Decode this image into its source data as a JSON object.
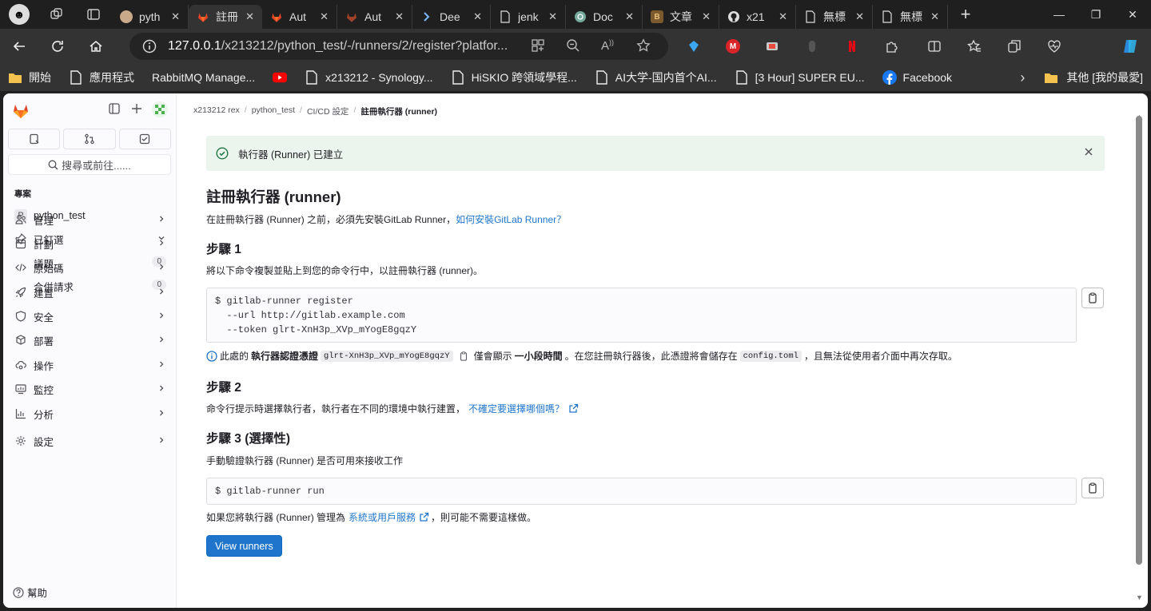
{
  "tabs": [
    {
      "title": "pyth",
      "fav": "person-avatar"
    },
    {
      "title": "註冊",
      "fav": "gitlab-fox",
      "active": true
    },
    {
      "title": "Aut",
      "fav": "gitlab-fox"
    },
    {
      "title": "Aut",
      "fav": "gitlab-fox-dark"
    },
    {
      "title": "Dee",
      "fav": "chevron-app"
    },
    {
      "title": "jenk",
      "fav": "document"
    },
    {
      "title": "Doc",
      "fav": "chatgpt"
    },
    {
      "title": "文章",
      "fav": "blog"
    },
    {
      "title": "x21",
      "fav": "github"
    },
    {
      "title": "無標",
      "fav": "document"
    },
    {
      "title": "無標",
      "fav": "document"
    }
  ],
  "address": {
    "url_host": "127.0.0.1",
    "url_path": "/x213212/python_test/-/runners/2/register?platfor..."
  },
  "bookmarks": [
    {
      "label": "開始",
      "icon": "folder"
    },
    {
      "label": "應用程式",
      "icon": "page"
    },
    {
      "label": "RabbitMQ Manage...",
      "icon": "none"
    },
    {
      "label": "",
      "icon": "youtube"
    },
    {
      "label": "x213212 - Synology...",
      "icon": "page"
    },
    {
      "label": "HiSKIO 跨領域學程...",
      "icon": "page"
    },
    {
      "label": "AI大学-国内首个AI...",
      "icon": "page"
    },
    {
      "label": "[3 Hour] SUPER EU...",
      "icon": "page"
    },
    {
      "label": "Facebook",
      "icon": "facebook"
    }
  ],
  "bookmarks_other": "其他 [我的最愛]",
  "sidebar": {
    "search": "搜尋或前往......",
    "section": "專案",
    "project": {
      "badge": "P",
      "name": "python_test"
    },
    "pinned": "已釘選",
    "pinned_items": [
      {
        "label": "議題",
        "count": "0"
      },
      {
        "label": "合併請求",
        "count": "0"
      }
    ],
    "items": [
      {
        "label": "管理",
        "icon": "users-icon"
      },
      {
        "label": "計劃",
        "icon": "calendar-icon"
      },
      {
        "label": "原始碼",
        "icon": "code-icon"
      },
      {
        "label": "建置",
        "icon": "rocket-icon"
      },
      {
        "label": "安全",
        "icon": "shield-icon"
      },
      {
        "label": "部署",
        "icon": "deploy-icon"
      },
      {
        "label": "操作",
        "icon": "cloud-gear-icon"
      },
      {
        "label": "監控",
        "icon": "monitor-icon"
      },
      {
        "label": "分析",
        "icon": "chart-icon"
      },
      {
        "label": "設定",
        "icon": "gear-icon"
      }
    ],
    "help": "幫助"
  },
  "breadcrumbs": [
    "x213212 rex",
    "python_test",
    "CI/CD 設定",
    "註冊執行器 (runner)"
  ],
  "alert": "執行器 (Runner) 已建立",
  "title": "註冊執行器 (runner)",
  "intro": {
    "text": "在註冊執行器 (Runner) 之前，必須先安裝GitLab Runner，",
    "link": "如何安裝GitLab Runner？"
  },
  "step1": {
    "title": "步驟 1",
    "desc": "將以下命令複製並貼上到您的命令行中，以註冊執行器 (runner)。",
    "code": "$ gitlab-runner register\n  --url http://gitlab.example.com\n  --token glrt-XnH3p_XVp_mYogE8gqzY",
    "note_pre": "此處的",
    "note_bold1": "執行器認證憑證",
    "token": "glrt-XnH3p_XVp_mYogE8gqzY",
    "note_mid": "僅會顯示",
    "note_bold2": "一小段時間",
    "note_mid2": "。在您註冊執行器後，此憑證將會儲存在",
    "config": "config.toml",
    "note_end": "，且無法從使用者介面中再次存取。"
  },
  "step2": {
    "title": "步驟 2",
    "desc": "命令行提示時選擇執行者，執行者在不同的環境中執行建置，",
    "link": "不確定要選擇哪個嗎？"
  },
  "step3": {
    "title": "步驟 3 (選擇性)",
    "desc": "手動驗證執行器 (Runner) 是否可用來接收工作",
    "code": "$ gitlab-runner run",
    "note_pre": "如果您將執行器 (Runner) 管理為",
    "link": "系統或用戶服務",
    "note_end": "，則可能不需要這樣做。"
  },
  "button": "View runners",
  "colors": {
    "accent": "#1f75cb",
    "success_bg": "#ecf4ee",
    "gitlab_orange": "#e24329"
  }
}
